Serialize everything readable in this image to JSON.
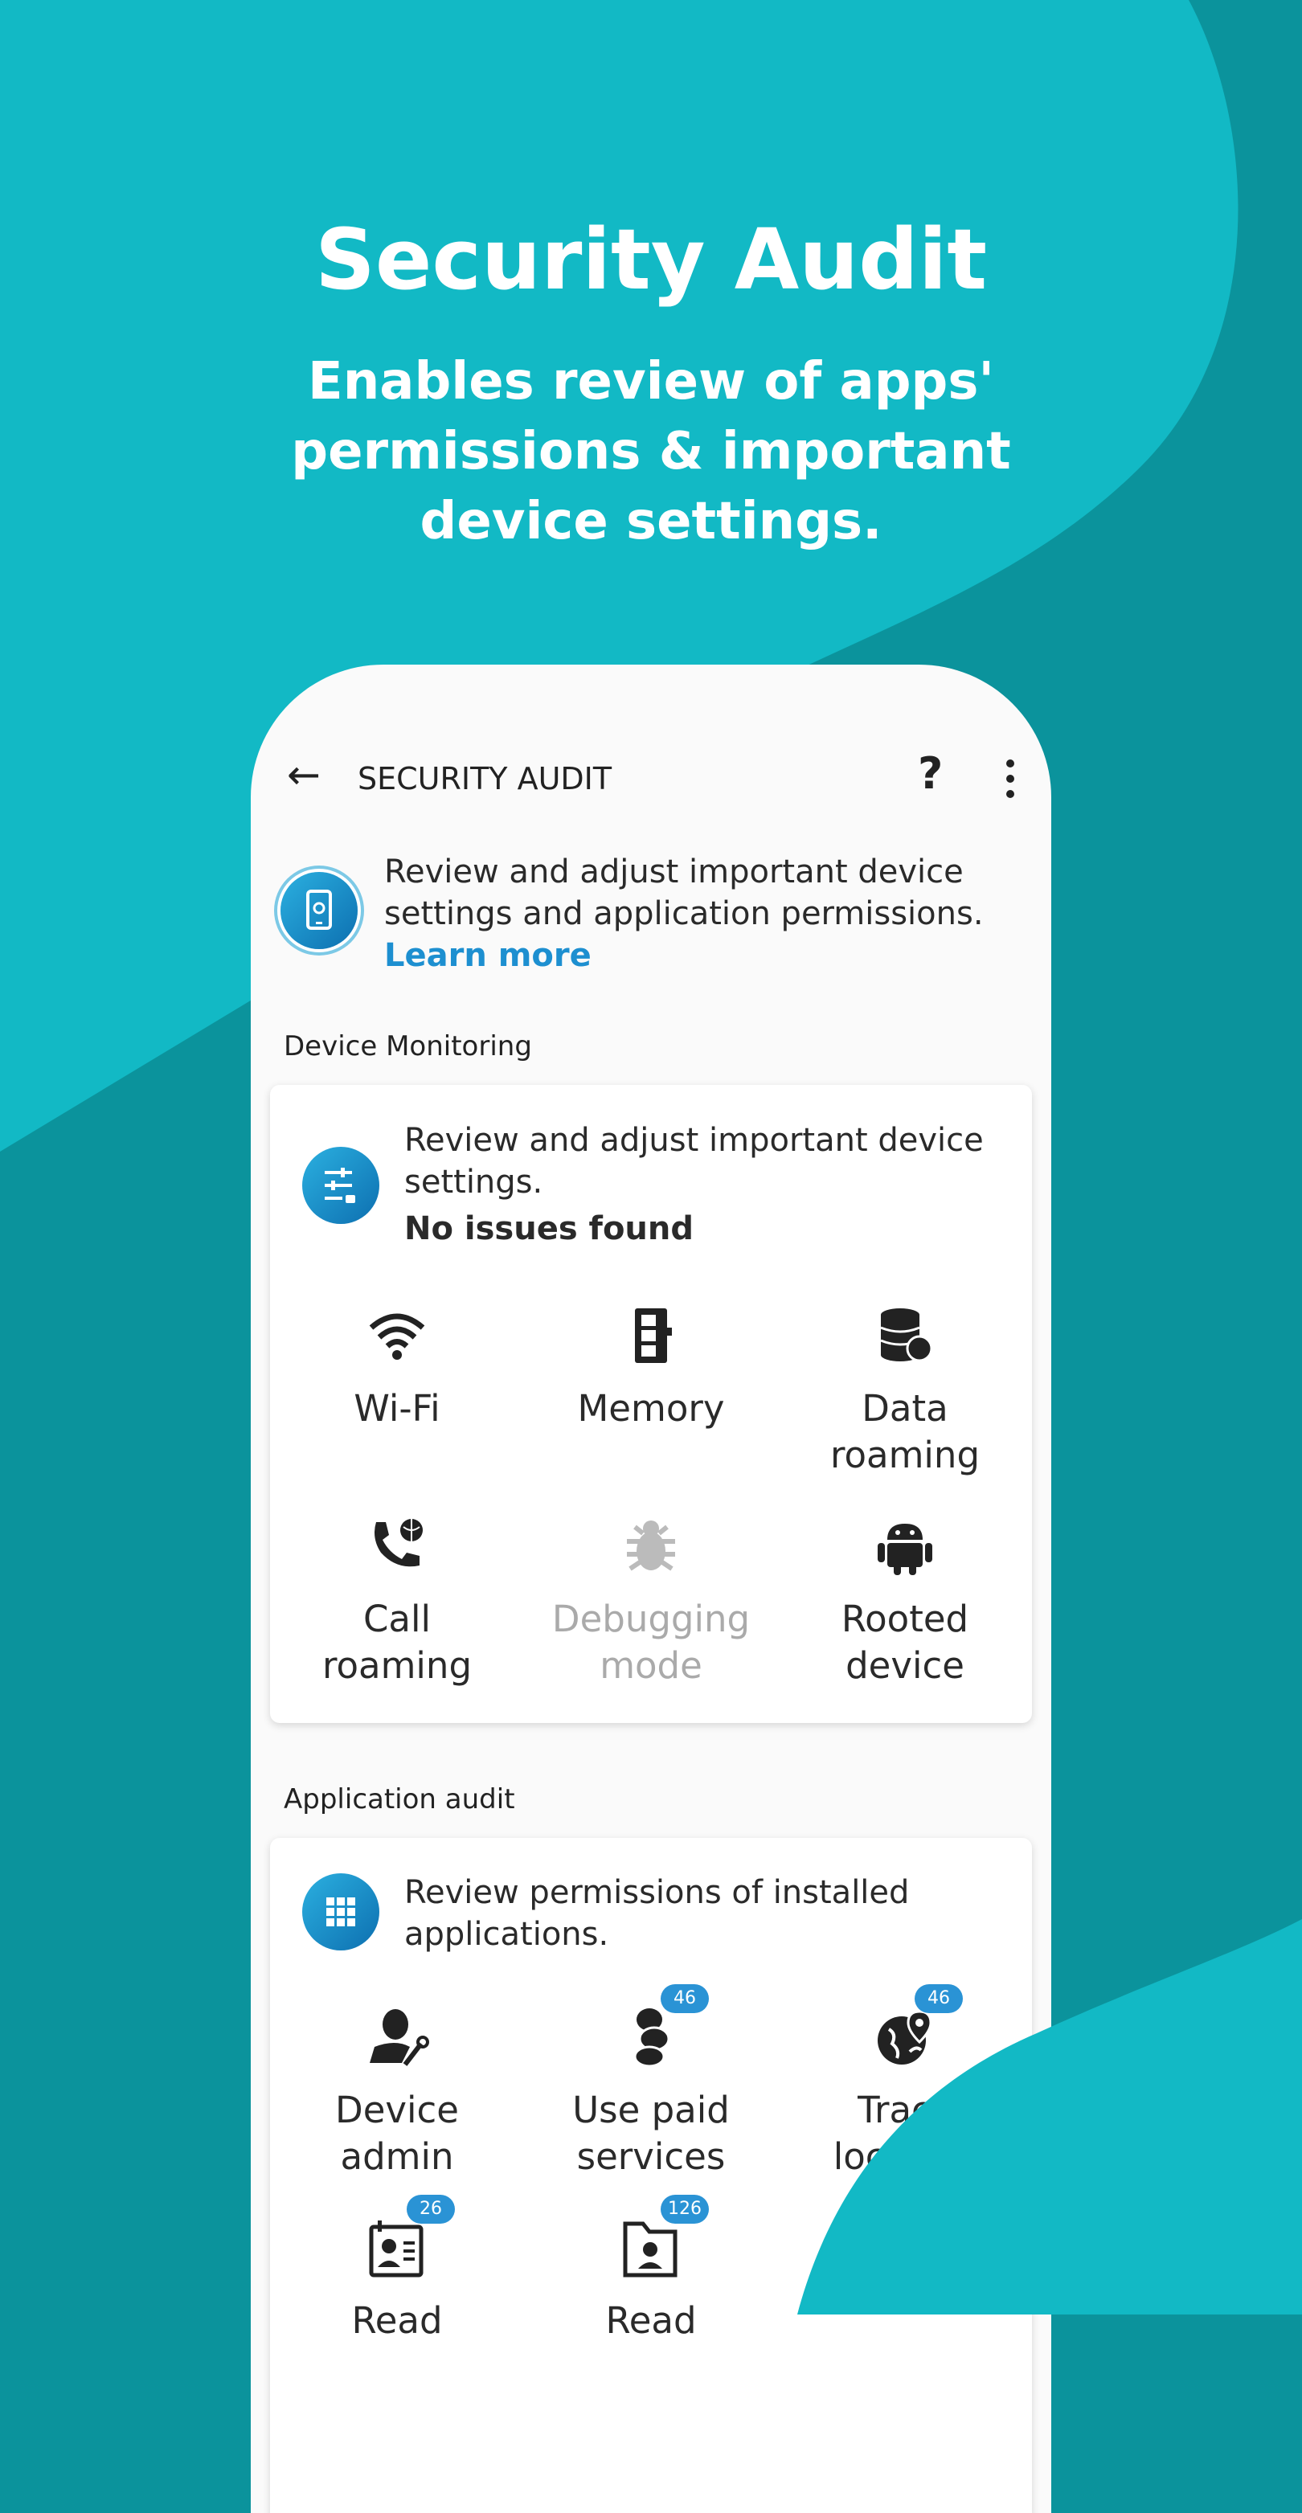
{
  "hero": {
    "title": "Security Audit",
    "subtitle_lines": [
      "Enables review of apps'",
      "permissions & important",
      "device settings."
    ]
  },
  "colors": {
    "teal_light": "#12b9c5",
    "teal_dark": "#0b939c",
    "accent": "#1d8fd0"
  },
  "app": {
    "title": "SECURITY AUDIT",
    "back_icon": "arrow-left",
    "help_label": "?",
    "menu_icon": "more-vertical"
  },
  "intro": {
    "lines": [
      "Review and adjust important device",
      "settings and application permissions."
    ],
    "learn_more": "Learn more"
  },
  "device_monitoring": {
    "section_title": "Device Monitoring",
    "desc_lines": [
      "Review and adjust important device",
      "settings."
    ],
    "status": "No issues found",
    "items": [
      {
        "icon": "wifi",
        "label1": "Wi-Fi",
        "label2": ""
      },
      {
        "icon": "memory",
        "label1": "Memory",
        "label2": ""
      },
      {
        "icon": "data-roaming",
        "label1": "Data",
        "label2": "roaming"
      },
      {
        "icon": "call-roaming",
        "label1": "Call",
        "label2": "roaming"
      },
      {
        "icon": "bug",
        "label1": "Debugging",
        "label2": "mode",
        "disabled": true
      },
      {
        "icon": "android",
        "label1": "Rooted",
        "label2": "device"
      }
    ]
  },
  "application_audit": {
    "section_title": "Application audit",
    "desc_lines": [
      "Review permissions of installed",
      "applications."
    ],
    "items": [
      {
        "icon": "device-admin",
        "label1": "Device",
        "label2": "admin",
        "badge": ""
      },
      {
        "icon": "coins",
        "label1": "Use paid",
        "label2": "services",
        "badge": "46"
      },
      {
        "icon": "globe-location",
        "label1": "Track",
        "label2": "location",
        "badge": "46"
      },
      {
        "icon": "contact-card",
        "label1": "Read",
        "label2": "",
        "badge": "26"
      },
      {
        "icon": "contact-folder",
        "label1": "Read",
        "label2": "",
        "badge": "126"
      }
    ]
  }
}
